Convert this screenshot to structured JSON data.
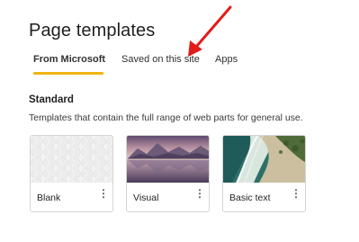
{
  "header": {
    "title": "Page templates"
  },
  "tabs": [
    {
      "label": "From Microsoft",
      "active": true
    },
    {
      "label": "Saved on this site",
      "active": false
    },
    {
      "label": "Apps",
      "active": false
    }
  ],
  "section": {
    "title": "Standard",
    "description": "Templates that contain the full range of web parts for general use."
  },
  "templates": [
    {
      "label": "Blank",
      "thumbnail": "blank-pattern-thumbnail"
    },
    {
      "label": "Visual",
      "thumbnail": "mountain-lake-thumbnail"
    },
    {
      "label": "Basic text",
      "thumbnail": "beach-aerial-thumbnail"
    }
  ],
  "more_glyph": "⋮",
  "colors": {
    "tab_indicator": "#f0b511",
    "annotation_arrow": "#e31b1b"
  }
}
